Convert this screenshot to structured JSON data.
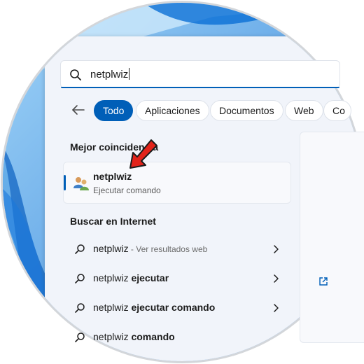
{
  "search": {
    "query": "netplwiz"
  },
  "filters": [
    {
      "label": "Todo",
      "active": true
    },
    {
      "label": "Aplicaciones",
      "active": false
    },
    {
      "label": "Documentos",
      "active": false
    },
    {
      "label": "Web",
      "active": false
    },
    {
      "label": "Co",
      "active": false
    }
  ],
  "best_match": {
    "heading": "Mejor coincidencia",
    "app": {
      "name": "netplwiz",
      "subtitle": "Ejecutar comando",
      "icon": "users-icon"
    }
  },
  "web": {
    "heading": "Buscar en Internet",
    "items": [
      {
        "prefix": "netplwiz",
        "bold": "",
        "hint": " - Ver resultados web"
      },
      {
        "prefix": "netplwiz ",
        "bold": "ejecutar",
        "hint": ""
      },
      {
        "prefix": "netplwiz ",
        "bold": "ejecutar comando",
        "hint": ""
      },
      {
        "prefix": "netplwiz ",
        "bold": "comando",
        "hint": ""
      }
    ]
  },
  "colors": {
    "accent": "#005fb8",
    "annotation": "#e2231a"
  }
}
